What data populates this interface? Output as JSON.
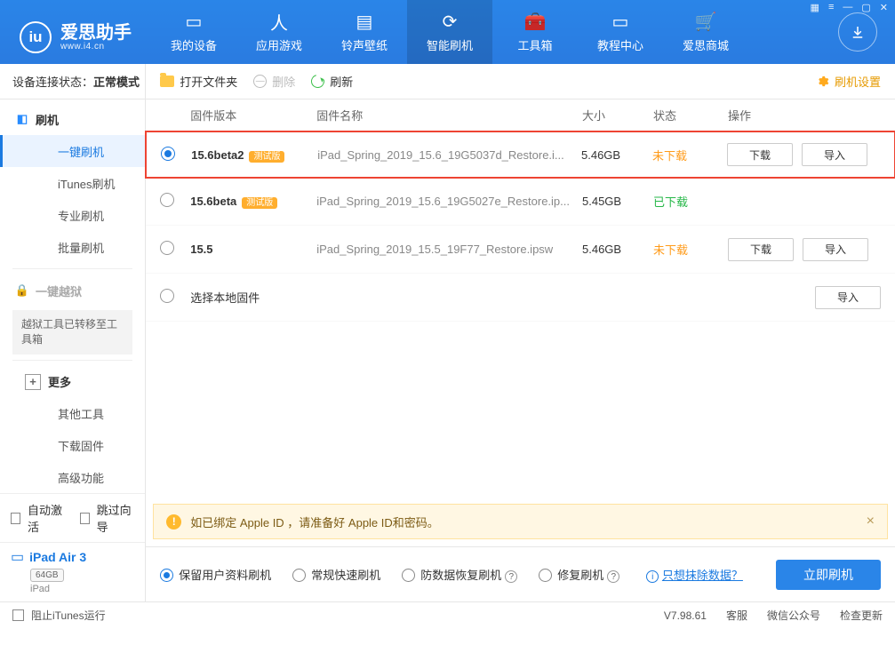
{
  "header": {
    "brand": "爱思助手",
    "brand_sub": "www.i4.cn",
    "nav": [
      {
        "label": "我的设备"
      },
      {
        "label": "应用游戏"
      },
      {
        "label": "铃声壁纸"
      },
      {
        "label": "智能刷机"
      },
      {
        "label": "工具箱"
      },
      {
        "label": "教程中心"
      },
      {
        "label": "爱思商城"
      }
    ]
  },
  "sidebar": {
    "conn_label": "设备连接状态：",
    "conn_value": "正常模式",
    "flash_label": "刷机",
    "items": [
      "一键刷机",
      "iTunes刷机",
      "专业刷机",
      "批量刷机"
    ],
    "jailbreak_label": "一键越狱",
    "jailbreak_note": "越狱工具已转移至工具箱",
    "more_label": "更多",
    "more_items": [
      "其他工具",
      "下载固件",
      "高级功能"
    ],
    "auto_activate": "自动激活",
    "skip_guide": "跳过向导",
    "device_name": "iPad Air 3",
    "device_storage": "64GB",
    "device_type": "iPad"
  },
  "toolbar": {
    "open_folder": "打开文件夹",
    "delete": "删除",
    "refresh": "刷新",
    "settings": "刷机设置"
  },
  "thead": {
    "version": "固件版本",
    "name": "固件名称",
    "size": "大小",
    "status": "状态",
    "ops": "操作"
  },
  "rows": [
    {
      "selected": true,
      "highlight": true,
      "version": "15.6beta2",
      "beta": "测试版",
      "name": "iPad_Spring_2019_15.6_19G5037d_Restore.i...",
      "size": "5.46GB",
      "status": "未下载",
      "status_class": "s-no",
      "download": "下载",
      "import": "导入"
    },
    {
      "selected": false,
      "highlight": false,
      "version": "15.6beta",
      "beta": "测试版",
      "name": "iPad_Spring_2019_15.6_19G5027e_Restore.ip...",
      "size": "5.45GB",
      "status": "已下载",
      "status_class": "s-ok"
    },
    {
      "selected": false,
      "highlight": false,
      "version": "15.5",
      "beta": "",
      "name": "iPad_Spring_2019_15.5_19F77_Restore.ipsw",
      "size": "5.46GB",
      "status": "未下载",
      "status_class": "s-no",
      "download": "下载",
      "import": "导入"
    },
    {
      "selected": false,
      "highlight": false,
      "select_local": "选择本地固件",
      "import": "导入"
    }
  ],
  "info": {
    "text": "如已绑定 Apple ID ，请准备好 Apple ID和密码。"
  },
  "options": {
    "opts": [
      {
        "label": "保留用户资料刷机",
        "on": true
      },
      {
        "label": "常规快速刷机",
        "on": false
      },
      {
        "label": "防数据恢复刷机",
        "on": false,
        "q": true
      },
      {
        "label": "修复刷机",
        "on": false,
        "q": true
      }
    ],
    "erase_link": "只想抹除数据？",
    "flash_btn": "立即刷机"
  },
  "footer": {
    "block_itunes": "阻止iTunes运行",
    "version": "V7.98.61",
    "service": "客服",
    "wechat": "微信公众号",
    "update": "检查更新"
  }
}
